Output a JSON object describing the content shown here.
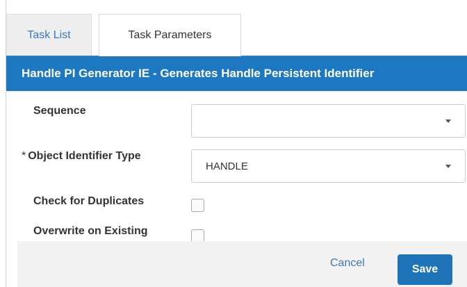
{
  "tabs": {
    "task_list": "Task List",
    "task_parameters": "Task Parameters"
  },
  "header": {
    "title": "Handle PI Generator IE - Generates Handle Persistent Identifier"
  },
  "form": {
    "sequence": {
      "label": "Sequence",
      "value": ""
    },
    "object_identifier_type": {
      "required_mark": "*",
      "label": "Object Identifier Type",
      "value": "HANDLE"
    },
    "check_duplicates": {
      "label": "Check for Duplicates",
      "checked": false
    },
    "overwrite_existing": {
      "label": "Overwrite on Existing",
      "checked": false
    }
  },
  "footer": {
    "cancel_label": "Cancel",
    "save_label": "Save"
  },
  "colors": {
    "accent": "#1d78c1",
    "link": "#3b79b8"
  }
}
